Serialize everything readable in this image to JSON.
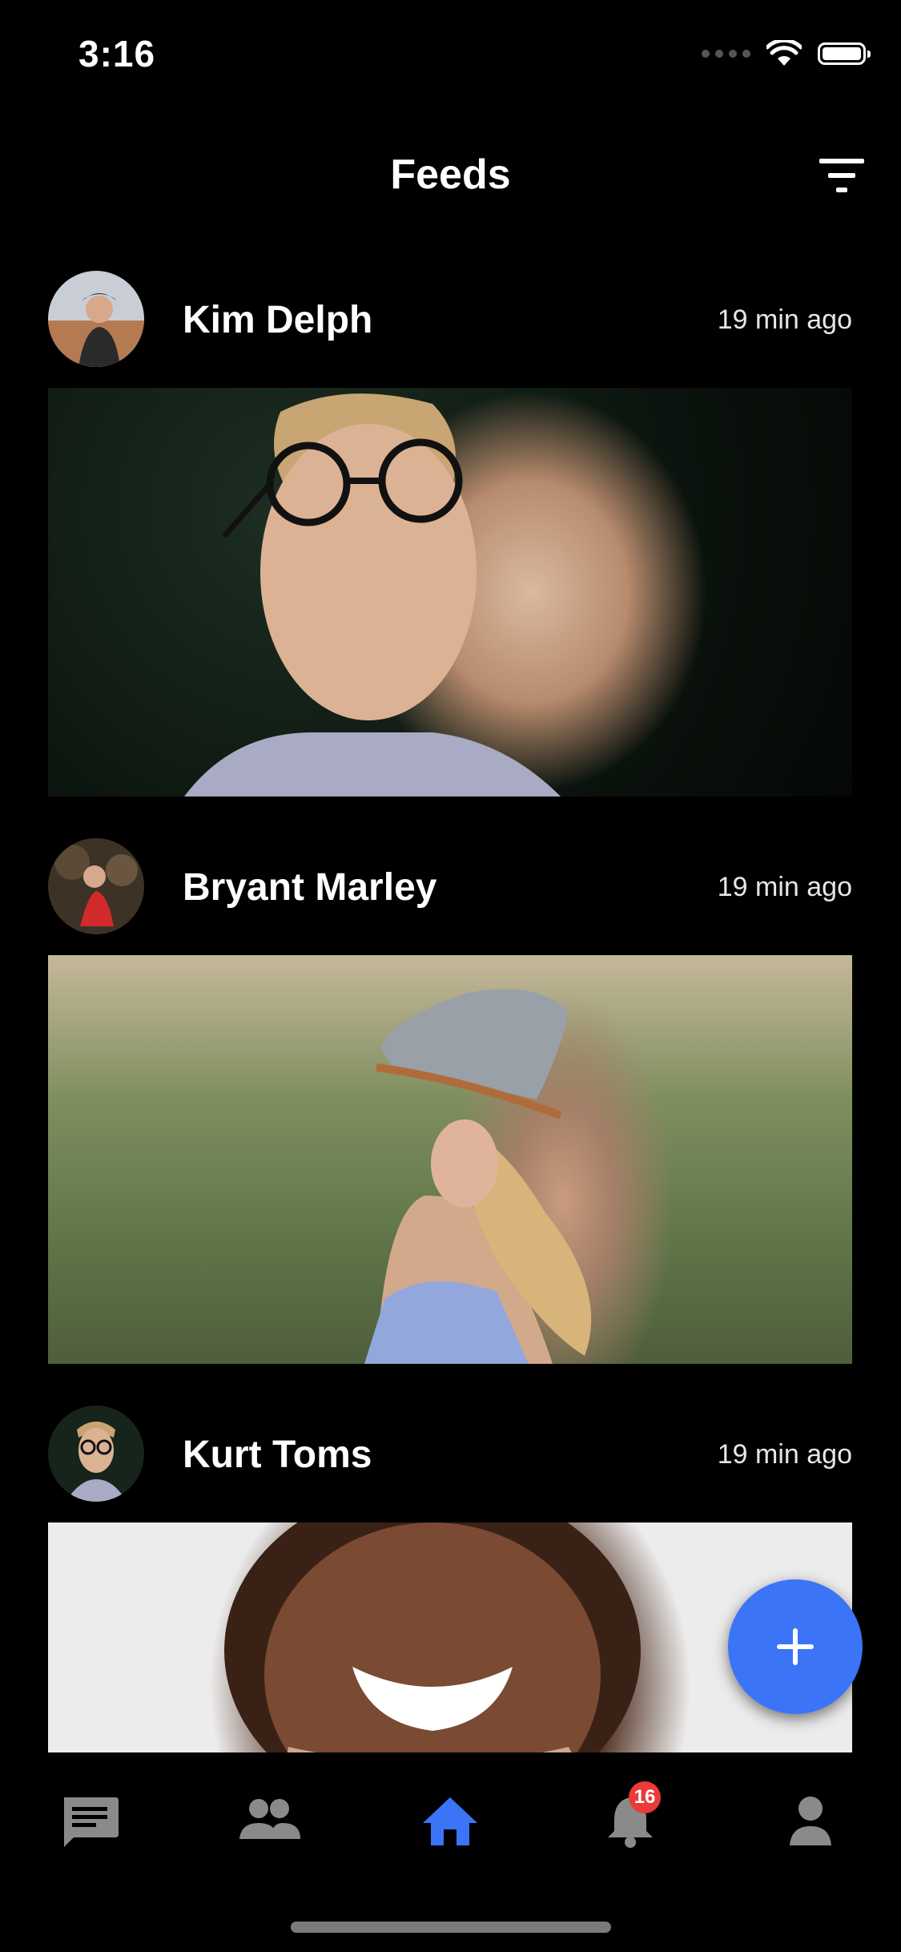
{
  "status_bar": {
    "time": "3:16"
  },
  "header": {
    "title": "Feeds"
  },
  "posts": [
    {
      "author": "Kim Delph",
      "time": "19 min ago"
    },
    {
      "author": "Bryant Marley",
      "time": "19 min ago"
    },
    {
      "author": "Kurt Toms",
      "time": "19 min ago"
    }
  ],
  "tabs": [
    {
      "icon": "chat-icon"
    },
    {
      "icon": "people-icon"
    },
    {
      "icon": "home-icon",
      "active": true
    },
    {
      "icon": "bell-icon",
      "badge": "16"
    },
    {
      "icon": "person-icon"
    }
  ],
  "colors": {
    "accent": "#3b74f7",
    "badge": "#ea3a3a",
    "inactive_tab": "#8a8a8a"
  }
}
